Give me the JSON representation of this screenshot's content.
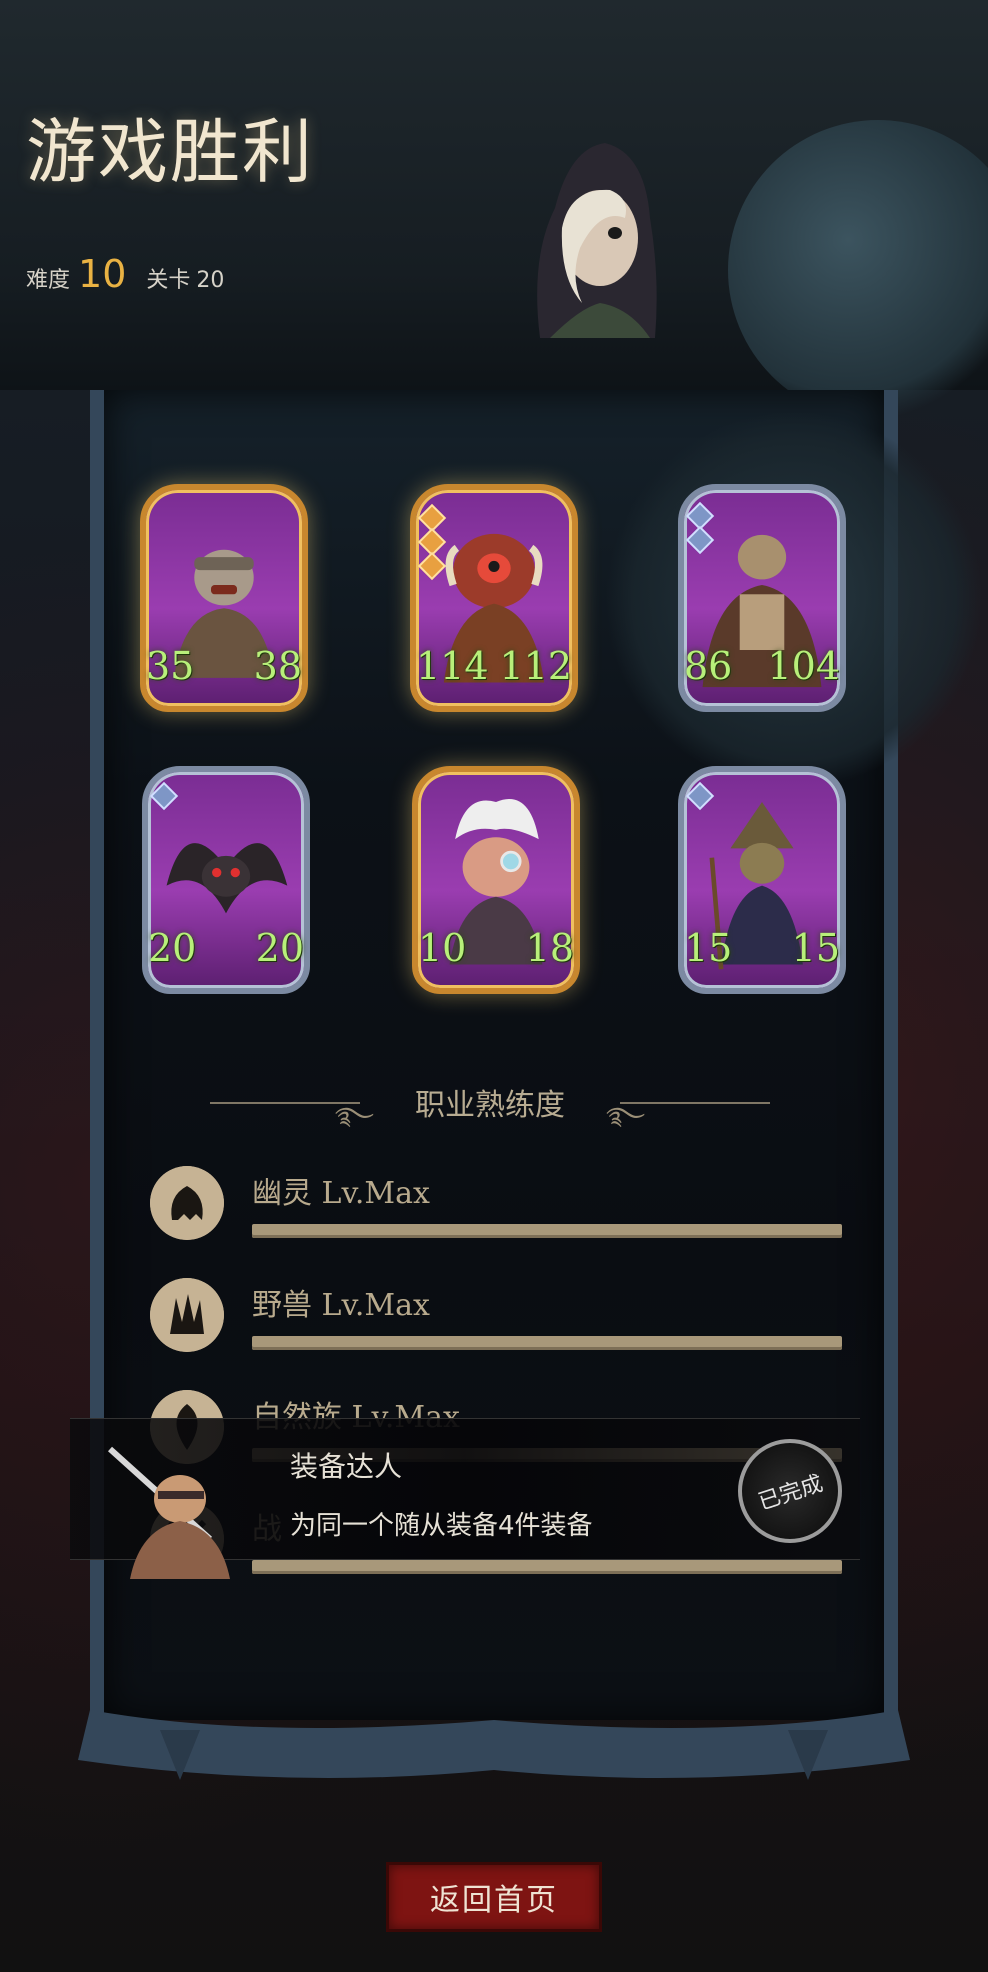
{
  "header": {
    "title": "游戏胜利",
    "difficulty_label": "难度",
    "difficulty_value": "10",
    "level_label": "关卡",
    "level_value": "20"
  },
  "cards": [
    {
      "atk": "35",
      "hp": "38",
      "frame": "gold",
      "portrait": "bald-brute-icon"
    },
    {
      "atk": "114",
      "hp": "112",
      "frame": "gold",
      "portrait": "red-ogre-icon"
    },
    {
      "atk": "86",
      "hp": "104",
      "frame": "silver",
      "portrait": "zombie-giant-icon"
    },
    {
      "atk": "20",
      "hp": "20",
      "frame": "silver",
      "portrait": "bat-icon"
    },
    {
      "atk": "10",
      "hp": "18",
      "frame": "gold",
      "portrait": "old-goblin-icon"
    },
    {
      "atk": "15",
      "hp": "15",
      "frame": "silver",
      "portrait": "scarecrow-icon"
    }
  ],
  "proficiency": {
    "title": "职业熟练度",
    "items": [
      {
        "name": "幽灵 Lv.Max",
        "icon": "ghost-class-icon"
      },
      {
        "name": "野兽 Lv.Max",
        "icon": "beast-class-icon"
      },
      {
        "name": "自然族 Lv.Max",
        "icon": "nature-class-icon"
      },
      {
        "name": "战",
        "icon": "warrior-class-icon"
      }
    ]
  },
  "achievement": {
    "title": "装备达人",
    "description": "为同一个随从装备4件装备",
    "status": "已完成"
  },
  "footer": {
    "back_button": "返回首页"
  },
  "colors": {
    "stat_green": "#b8f07a",
    "title_cream": "#f1e6cf",
    "difficulty_gold": "#e9b243",
    "button_red": "#7e1412"
  }
}
